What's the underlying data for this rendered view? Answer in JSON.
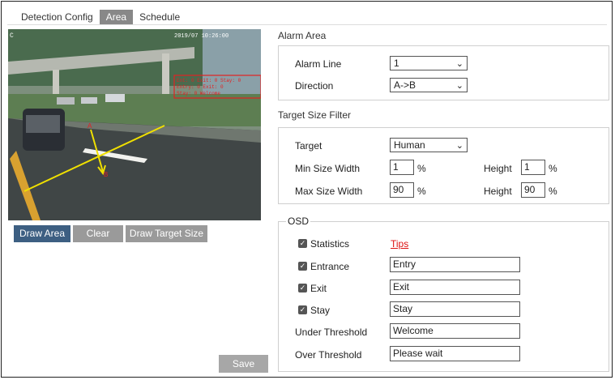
{
  "tabs": [
    "Detection Config",
    "Area",
    "Schedule"
  ],
  "active_tab": "Area",
  "video": {
    "overlay_left": "C",
    "overlay_time": "2019/07 10:26:00",
    "red_lines": [
      "Ent: 0  Exit: 0  Stay: 0",
      "Entry: 0  Exit: 0",
      "Stay: 0  Welcome"
    ]
  },
  "video_buttons": {
    "draw_area": "Draw Area",
    "clear": "Clear",
    "draw_target_size": "Draw Target Size"
  },
  "save_label": "Save",
  "alarm_area": {
    "title": "Alarm Area",
    "alarm_line_label": "Alarm Line",
    "alarm_line_value": "1",
    "direction_label": "Direction",
    "direction_value": "A->B"
  },
  "target_filter": {
    "title": "Target Size Filter",
    "target_label": "Target",
    "target_value": "Human",
    "min_label": "Min Size Width",
    "min_width": "1",
    "min_height_label": "Height",
    "min_height": "1",
    "max_label": "Max Size Width",
    "max_width": "90",
    "max_height_label": "Height",
    "max_height": "90",
    "unit": "%"
  },
  "osd": {
    "title": "OSD",
    "statistics_label": "Statistics",
    "tips_label": "Tips",
    "entrance_label": "Entrance",
    "entrance_value": "Entry",
    "exit_label": "Exit",
    "exit_value": "Exit",
    "stay_label": "Stay",
    "stay_value": "Stay",
    "under_label": "Under Threshold",
    "under_value": "Welcome",
    "over_label": "Over Threshold",
    "over_value": "Please wait",
    "check_glyph": "✓"
  },
  "colors": {
    "active_tab": "#888888",
    "draw_area_button": "#3d5f82",
    "line": "#f0e000",
    "tips": "#dd1111"
  },
  "icons": {
    "select_arrow": "chevron-down-icon",
    "checkbox": "checkbox-checked-icon"
  }
}
